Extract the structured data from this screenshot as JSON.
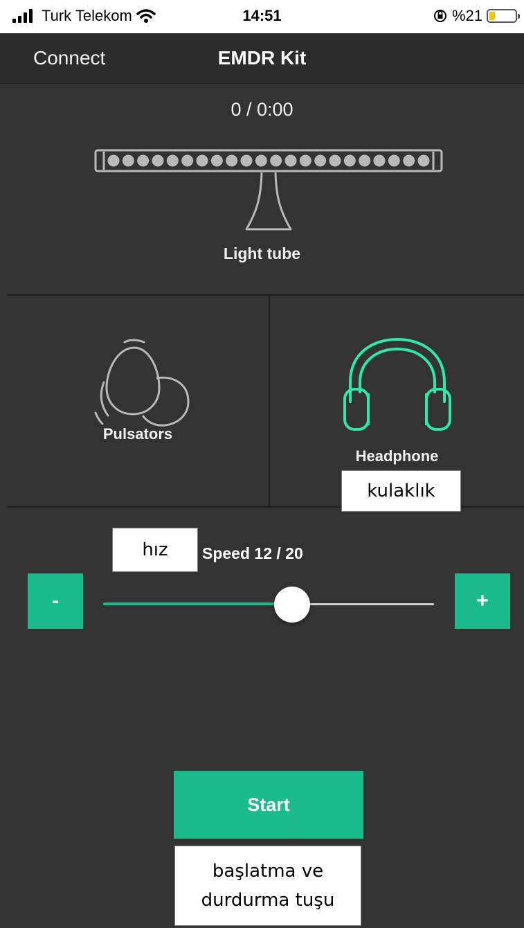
{
  "status_bar": {
    "carrier": "Turk Telekom",
    "time": "14:51",
    "battery": "%21",
    "battery_level": 0.21
  },
  "nav": {
    "left_button": "Connect",
    "title": "EMDR Kit"
  },
  "session": {
    "counter": "0 / 0:00"
  },
  "devices": {
    "light_tube": {
      "label": "Light tube",
      "led_count": 22
    },
    "pulsators": {
      "label": "Pulsators"
    },
    "headphone": {
      "label": "Headphone",
      "active_color": "#2ee8a8"
    }
  },
  "speed": {
    "label": "Speed 12 / 20",
    "value": 12,
    "max": 20,
    "decrement_label": "-",
    "increment_label": "+"
  },
  "start_button": {
    "label": "Start"
  },
  "annotations": {
    "headphone_note": "kulaklık",
    "speed_note": "hız",
    "start_note_line1": "başlatma ve",
    "start_note_line2": "durdurma tuşu"
  },
  "colors": {
    "accent": "#1abc8c",
    "background": "#333333",
    "navbar": "#2c2c2c",
    "inactive_icon": "#b9b9b9"
  }
}
